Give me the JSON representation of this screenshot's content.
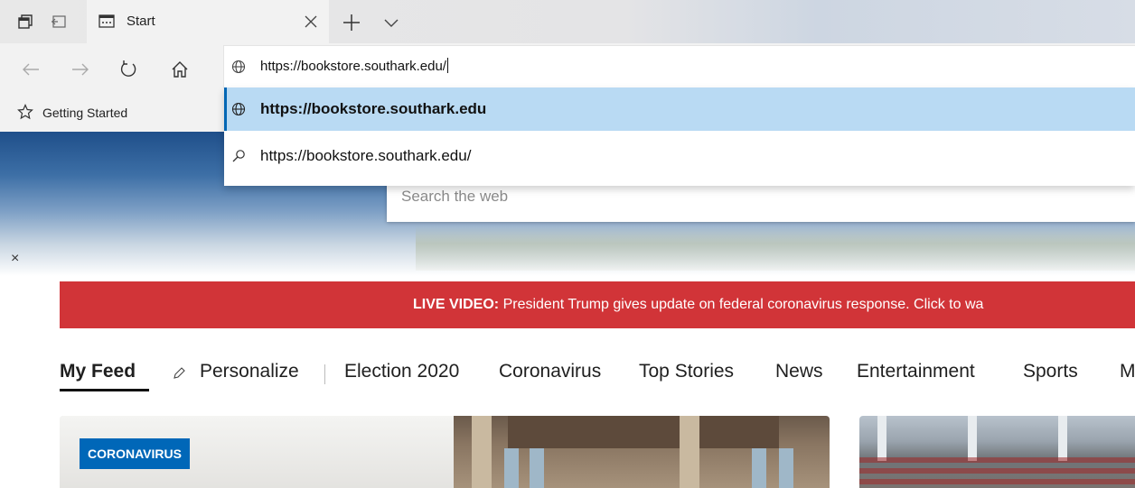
{
  "tab_strip": {
    "tab_title": "Start"
  },
  "address_bar": {
    "value": "https://bookstore.southark.edu/"
  },
  "suggestions": [
    {
      "text": "https://bookstore.southark.edu",
      "icon": "globe-icon"
    },
    {
      "text": "https://bookstore.southark.edu/",
      "icon": "search-icon"
    }
  ],
  "favorites_bar": {
    "items": [
      {
        "label": "Getting Started",
        "icon": "star-icon"
      }
    ]
  },
  "hero": {
    "search_placeholder": "Search the web",
    "dismiss_label": "×"
  },
  "banner": {
    "prefix": "LIVE VIDEO:",
    "text": " President Trump gives update on federal coronavirus response. Click to wa",
    "color": "#d13438"
  },
  "feed_nav": {
    "my_feed": "My Feed",
    "personalize": "Personalize",
    "items": [
      "Election 2020",
      "Coronavirus",
      "Top Stories",
      "News",
      "Entertainment",
      "Sports",
      "M"
    ]
  },
  "cards": {
    "badge": "CORONAVIRUS",
    "badge_color": "#0067b8"
  }
}
